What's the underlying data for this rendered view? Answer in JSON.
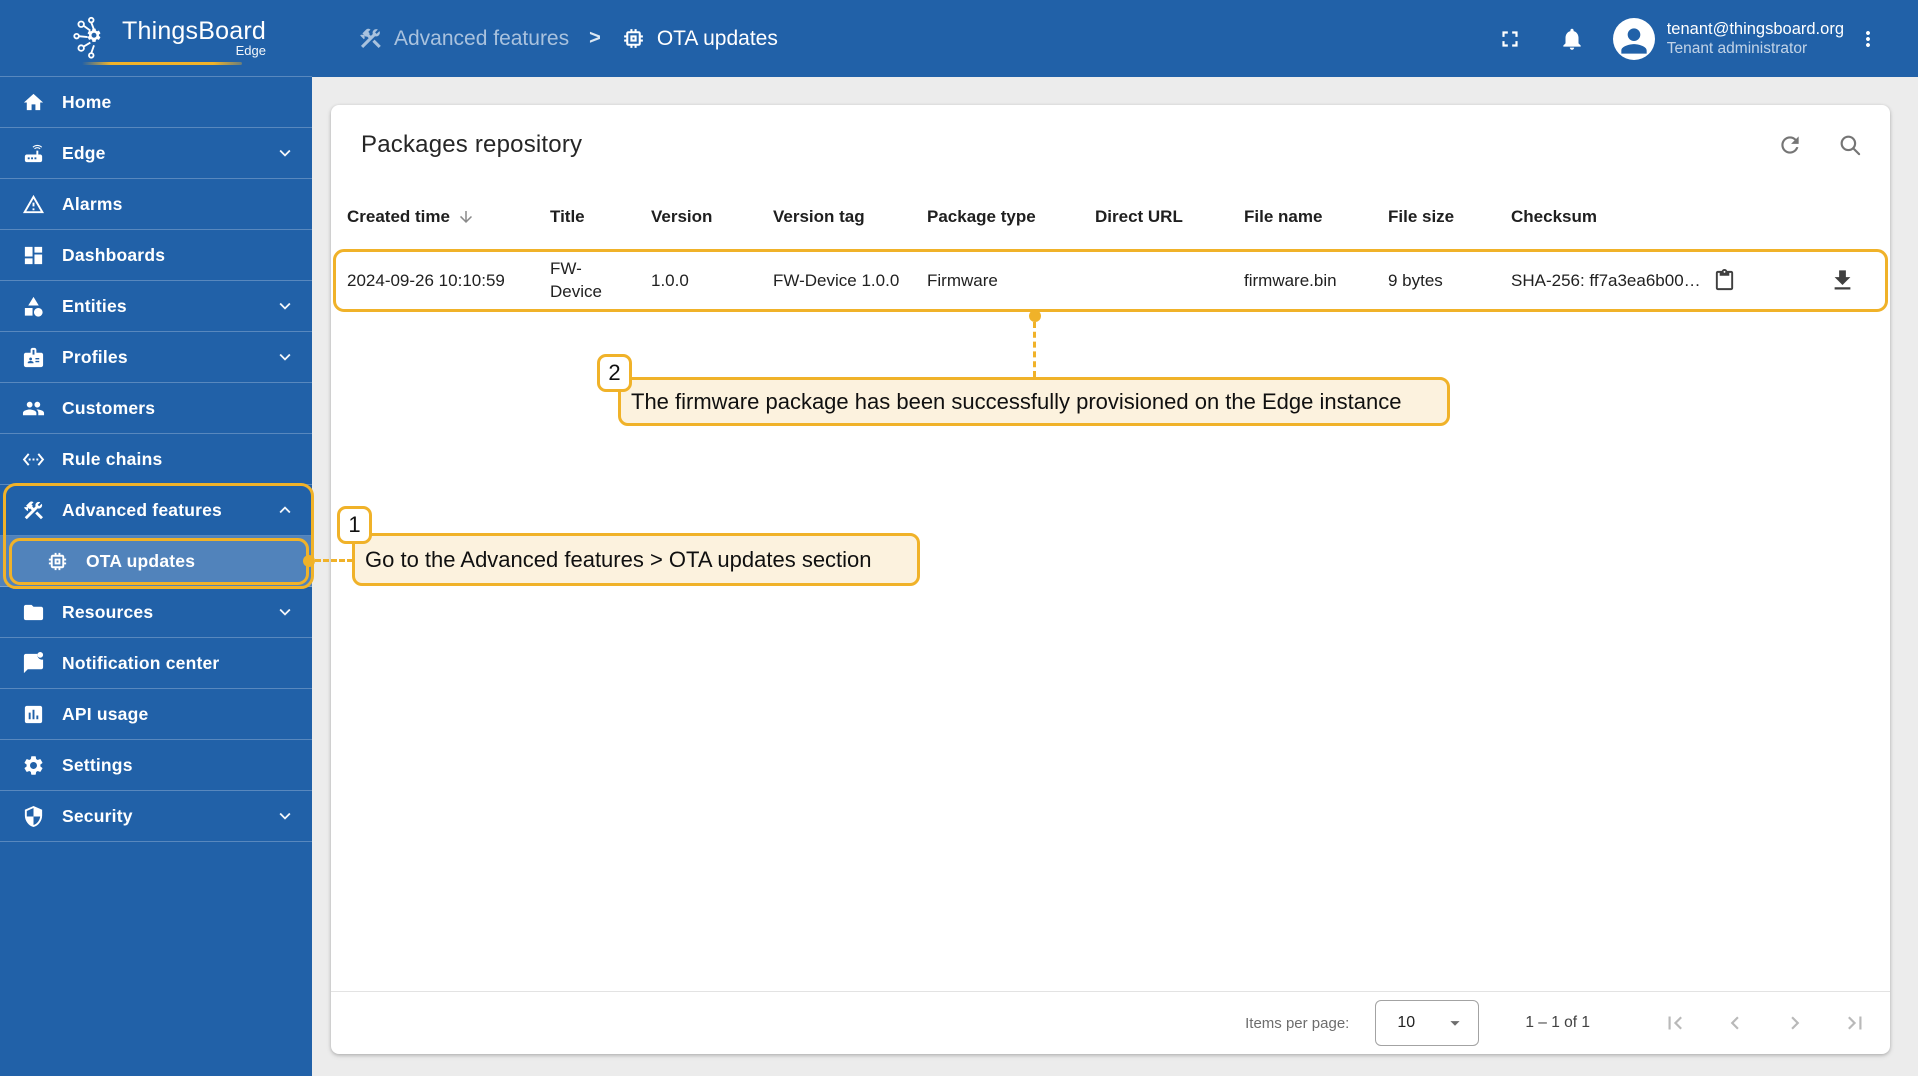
{
  "app": {
    "name": "ThingsBoard",
    "edition": "Edge"
  },
  "colors": {
    "primary_blue": "#2161a8",
    "accent_yellow": "#f0b229",
    "annotation_fill": "#fcf2de"
  },
  "sidebar": {
    "items": [
      {
        "label": "Home",
        "icon": "home-icon"
      },
      {
        "label": "Edge",
        "icon": "router-icon",
        "chevron": "down"
      },
      {
        "label": "Alarms",
        "icon": "warning-icon"
      },
      {
        "label": "Dashboards",
        "icon": "dashboard-icon"
      },
      {
        "label": "Entities",
        "icon": "category-icon",
        "chevron": "down"
      },
      {
        "label": "Profiles",
        "icon": "badge-icon",
        "chevron": "down"
      },
      {
        "label": "Customers",
        "icon": "people-icon"
      },
      {
        "label": "Rule chains",
        "icon": "ethernet-icon"
      },
      {
        "label": "Advanced features",
        "icon": "construction-icon",
        "chevron": "up"
      },
      {
        "label": "OTA updates",
        "icon": "memory-chip-icon",
        "selected": true
      },
      {
        "label": "Resources",
        "icon": "folder-icon",
        "chevron": "down"
      },
      {
        "label": "Notification center",
        "icon": "chat-unread-icon"
      },
      {
        "label": "API usage",
        "icon": "chart-icon"
      },
      {
        "label": "Settings",
        "icon": "gear-icon"
      },
      {
        "label": "Security",
        "icon": "shield-icon",
        "chevron": "down"
      }
    ]
  },
  "header": {
    "breadcrumb": [
      {
        "label": "Advanced features",
        "icon": "construction-icon"
      },
      {
        "label": "OTA updates",
        "icon": "memory-chip-icon"
      }
    ],
    "separator": ">",
    "user": {
      "email": "tenant@thingsboard.org",
      "role": "Tenant administrator"
    }
  },
  "main": {
    "title": "Packages repository",
    "table": {
      "columns": [
        "Created time",
        "Title",
        "Version",
        "Version tag",
        "Package type",
        "Direct URL",
        "File name",
        "File size",
        "Checksum"
      ],
      "sorted_column": "Created time",
      "sort_direction": "desc",
      "rows": [
        {
          "created_time": "2024-09-26 10:10:59",
          "title": "FW-Device",
          "version": "1.0.0",
          "version_tag": "FW-Device 1.0.0",
          "package_type": "Firmware",
          "direct_url": "",
          "file_name": "firmware.bin",
          "file_size": "9 bytes",
          "checksum": "SHA-256: ff7a3ea6b00…"
        }
      ]
    },
    "pagination": {
      "items_per_page_label": "Items per page:",
      "page_size": "10",
      "range": "1 – 1 of 1"
    }
  },
  "annotations": {
    "step1": {
      "number": "1",
      "text": "Go to the Advanced features > OTA updates section"
    },
    "step2": {
      "number": "2",
      "text": "The firmware package has been successfully provisioned on the Edge instance"
    }
  }
}
